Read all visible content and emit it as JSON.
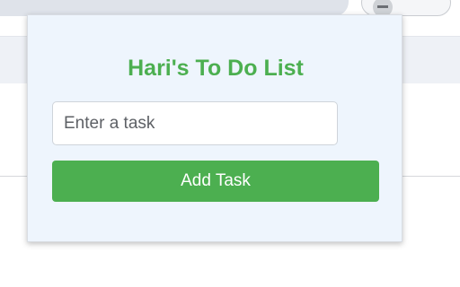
{
  "popup": {
    "title": "Hari's To Do List",
    "input": {
      "value": "",
      "placeholder": "Enter a task"
    },
    "add_button_label": "Add Task"
  },
  "colors": {
    "accent": "#4caf50",
    "popup_background": "#eef5fd"
  },
  "icons": {
    "extension": "extension-icon"
  }
}
